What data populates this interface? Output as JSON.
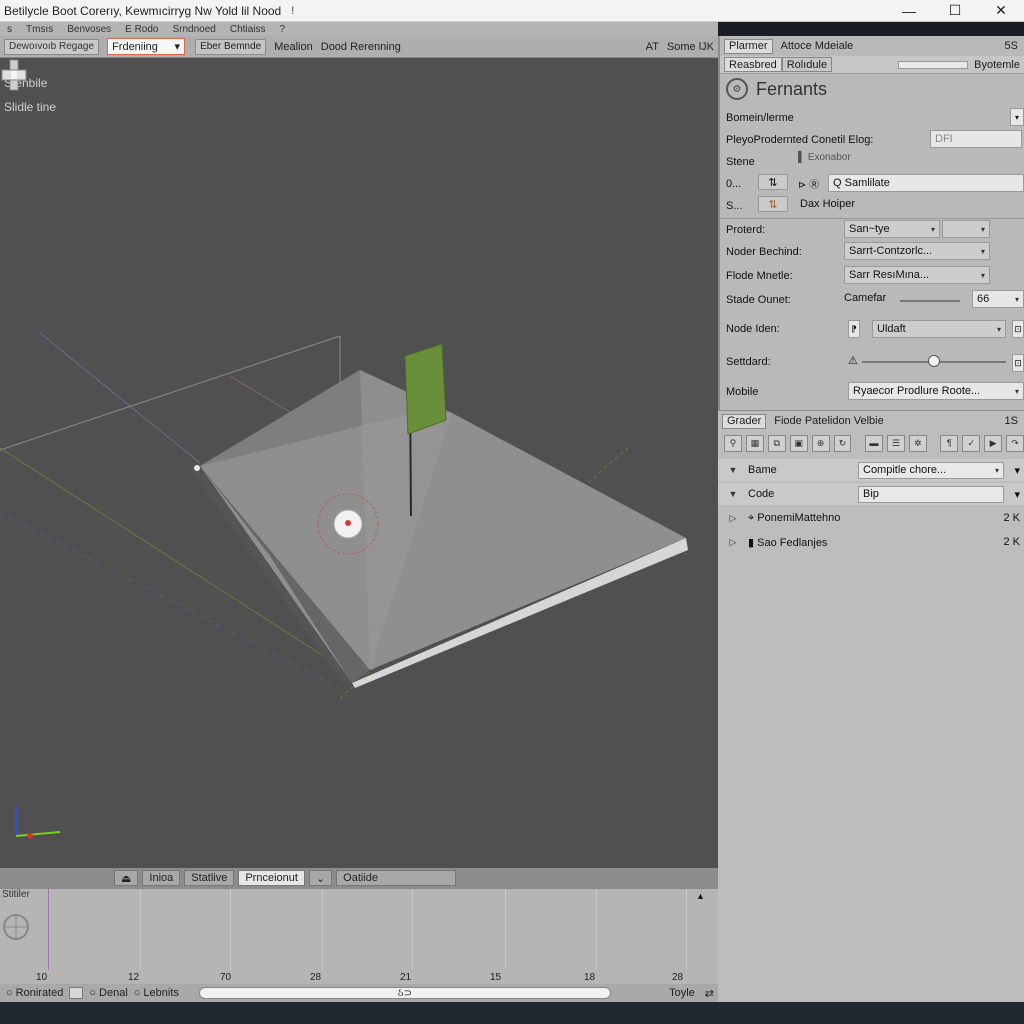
{
  "window": {
    "title": "Betilycle Boot Corerıy, Kewmıcirryg Nw Yold lil Nood",
    "pin": "!",
    "min": "—",
    "max": "☐",
    "close": "✕"
  },
  "menubar": [
    "s",
    "Tmsıs",
    "Benvoses",
    "E Rodo",
    "Srndnoed",
    "Chtiaiss",
    "?"
  ],
  "toolbar": {
    "chip": "Dewoıvoıb Regage",
    "select": "Frdeniing",
    "select_arrow": "▾",
    "button": "Eber Bemnde",
    "label1": "Mealion",
    "label2": "Dood Rerenning",
    "right1": "AT",
    "right2": "Some lJK"
  },
  "viewport": {
    "overlay1": "Stenbile",
    "overlay2": "Slidle tine",
    "colors": {
      "bg": "#505050",
      "top": "#8f8f8f",
      "left": "#6f6f6f",
      "edge": "#d6d6d6",
      "green": "#6a8f3a"
    }
  },
  "timeline_bar": {
    "tab1": "Inioa",
    "tab2": "Statlive",
    "tab3": "Prnceionut",
    "tab4": "Oatiide"
  },
  "timeline": {
    "track_label": "Stitiler",
    "ticks": [
      "10",
      "12",
      "70",
      "28",
      "21",
      "15",
      "18",
      "28"
    ]
  },
  "statusbar": {
    "item1": "Ronirated",
    "item2": "Denal",
    "item3": "Lebnits",
    "scroll_text": "ઠ⊃",
    "right1": "Toyle",
    "right2": "⇄"
  },
  "inspector": {
    "tab1": "Plarmer",
    "head1": "Attoce Mdeiale",
    "num1": "5S",
    "tab2": "Reasbred",
    "tab2b": "Rolıdule",
    "right2": "Byotemle",
    "component": "Fernants",
    "component_icon": "gear-icon",
    "rows": {
      "r1_label": "Bomein/lerme",
      "r2_label": "PleyoProdernted Conetil Elog:",
      "r2_value": "DFI",
      "r3_label": "Stene",
      "r3_value": "Exonabor",
      "r4_label": "0...",
      "r4_value": "Q Samlilate",
      "r5_label": "S...",
      "r5_value": "Dax Hoiper",
      "p1_label": "Proterd:",
      "p1_value": "San~tye",
      "p2_label": "Noder Bechind:",
      "p2_value": "Sarrt-Contzorlc...",
      "p3_label": "Flode Mnetle:",
      "p3_value": "Sarr ResıMına...",
      "p4_label": "Stade Ounet:",
      "p4_value": "Camefar",
      "p4_num": "66",
      "p5_label": "Node Iden:",
      "p5_value": "Uldaft",
      "p6_label": "Settdard:",
      "p7_label": "Mobile",
      "p7_value": "Ryaecor Prodlure Roote..."
    }
  },
  "graph": {
    "tab": "Grader",
    "title": "Fiode Patelidon Velbie",
    "num": "1S",
    "rows": [
      {
        "label": "Bame",
        "value": "Compitle chore...",
        "expanded": true
      },
      {
        "label": "Code",
        "value": "Bip",
        "expanded": true
      },
      {
        "label": "PonemiMattehno",
        "count": "2 K",
        "expanded": false
      },
      {
        "label": "Sao Fedlanjes",
        "count": "2 K",
        "expanded": false
      }
    ]
  }
}
